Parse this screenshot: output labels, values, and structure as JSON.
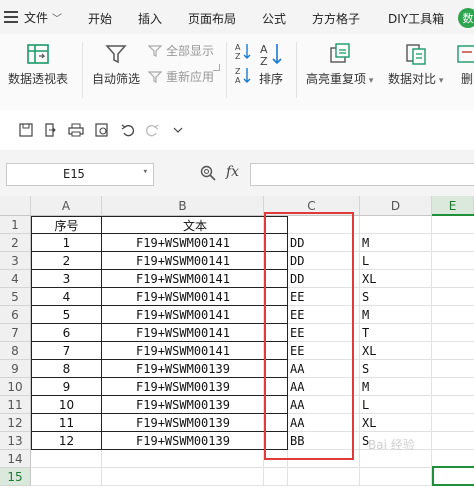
{
  "menu": {
    "file": "文件",
    "tabs": [
      "开始",
      "插入",
      "页面布局",
      "公式",
      "方方格子",
      "DIY工具箱"
    ],
    "badge": "数"
  },
  "ribbon": {
    "pivot": "数据透视表",
    "autofilter": "自动筛选",
    "show_all": "全部显示",
    "reapply": "重新应用",
    "sort": "排序",
    "highlight_dup": "高亮重复项",
    "compare": "数据对比",
    "remove_dup": "删"
  },
  "formula_bar": {
    "name_box": "E15",
    "fx": "fx",
    "formula": ""
  },
  "grid": {
    "columns": [
      "A",
      "B",
      "C",
      "D",
      "E"
    ],
    "rows": [
      "1",
      "2",
      "3",
      "4",
      "5",
      "6",
      "7",
      "8",
      "9",
      "10",
      "11",
      "12",
      "13",
      "14",
      "15"
    ],
    "header": {
      "a": "序号",
      "b": "文本"
    },
    "data": [
      {
        "a": "1",
        "b": "F19+WSWM00141",
        "c": "DD",
        "d": "M"
      },
      {
        "a": "2",
        "b": "F19+WSWM00141",
        "c": "DD",
        "d": "L"
      },
      {
        "a": "3",
        "b": "F19+WSWM00141",
        "c": "DD",
        "d": "XL"
      },
      {
        "a": "4",
        "b": "F19+WSWM00141",
        "c": "EE",
        "d": "S"
      },
      {
        "a": "5",
        "b": "F19+WSWM00141",
        "c": "EE",
        "d": "M"
      },
      {
        "a": "6",
        "b": "F19+WSWM00141",
        "c": "EE",
        "d": "T"
      },
      {
        "a": "7",
        "b": "F19+WSWM00141",
        "c": "EE",
        "d": "XL"
      },
      {
        "a": "8",
        "b": "F19+WSWM00139",
        "c": "AA",
        "d": "S"
      },
      {
        "a": "9",
        "b": "F19+WSWM00139",
        "c": "AA",
        "d": "M"
      },
      {
        "a": "10",
        "b": "F19+WSWM00139",
        "c": "AA",
        "d": "L"
      },
      {
        "a": "11",
        "b": "F19+WSWM00139",
        "c": "AA",
        "d": "XL"
      },
      {
        "a": "12",
        "b": "F19+WSWM00139",
        "c": "BB",
        "d": "S"
      }
    ],
    "active_cell": "E15"
  },
  "watermark": "Bai 经验",
  "colors": {
    "highlight_box": "#e03a3a",
    "selection": "#1f8f3a"
  }
}
